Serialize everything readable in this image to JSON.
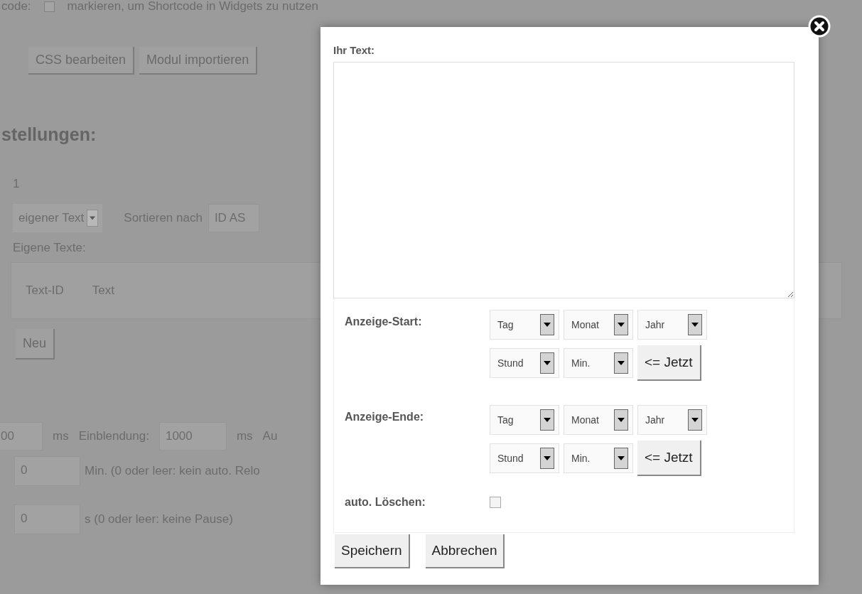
{
  "background": {
    "shortcode_row": {
      "label": "code:",
      "checked": false,
      "text": "markieren, um Shortcode in Widgets zu nutzen"
    },
    "buttons": [
      "CSS bearbeiten",
      "Modul importieren"
    ],
    "heading": "stellungen:",
    "number": "1",
    "source_select": {
      "value": "eigener Text"
    },
    "sort_label": "Sortieren nach",
    "sort_select": {
      "value": "ID AS"
    },
    "texts_label": "Eigene Texte:",
    "table": {
      "columns": [
        "Text-ID",
        "Text"
      ]
    },
    "new_button": "Neu",
    "timing_row": {
      "field_1": "00",
      "unit_1": "ms",
      "label": "Einblendung:",
      "field_2": "1000",
      "unit_2": "ms",
      "label_cut": "Au"
    },
    "reload_row": {
      "value": "0",
      "text": "Min. (0 oder leer: kein auto. Relo"
    },
    "pause_row": {
      "value": "0",
      "text": "s (0 oder leer: keine Pause)"
    }
  },
  "dialog": {
    "text_label": "Ihr Text:",
    "times": [
      {
        "label": "Anzeige-Start:",
        "date_selects": [
          "Tag",
          "Monat",
          "Jahr"
        ],
        "time_selects": [
          "Stund",
          "Min."
        ],
        "now_button": "<= Jetzt"
      },
      {
        "label": "Anzeige-Ende:",
        "date_selects": [
          "Tag",
          "Monat",
          "Jahr"
        ],
        "time_selects": [
          "Stund",
          "Min."
        ],
        "now_button": "<= Jetzt"
      }
    ],
    "auto_delete": {
      "label": "auto. Löschen:",
      "checked": false
    },
    "buttons": [
      "Speichern",
      "Abbrechen"
    ]
  }
}
